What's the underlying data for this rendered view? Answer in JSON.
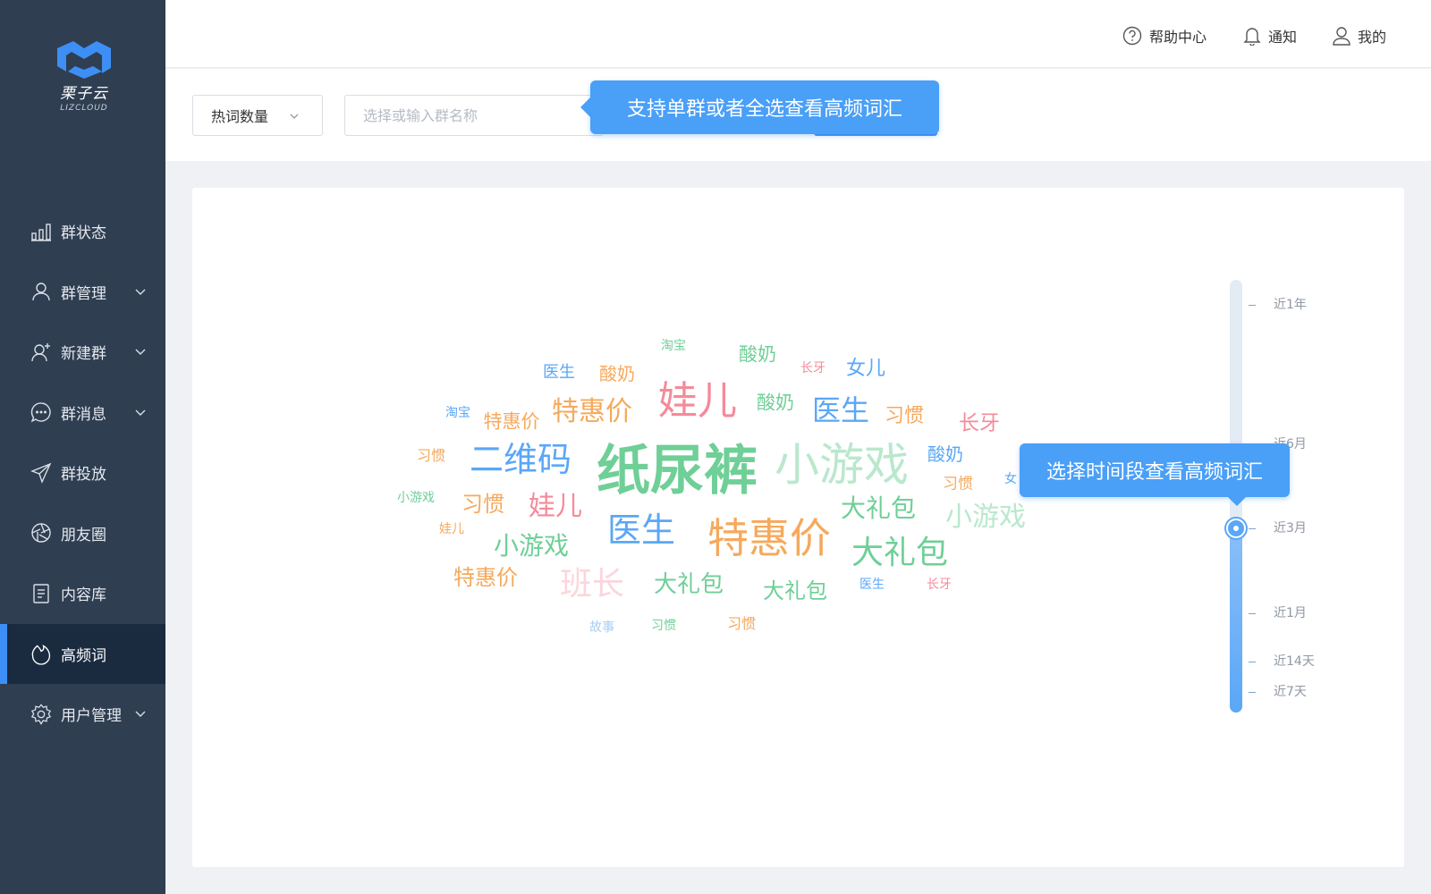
{
  "brand": {
    "name_cn": "栗子云",
    "name_en": "LIZCLOUD",
    "color": "#3d8ff5"
  },
  "sidebar": {
    "items": [
      {
        "label": "群状态",
        "icon": "bar-chart-icon",
        "has_submenu": false
      },
      {
        "label": "群管理",
        "icon": "user-icon",
        "has_submenu": true
      },
      {
        "label": "新建群",
        "icon": "add-user-icon",
        "has_submenu": true
      },
      {
        "label": "群消息",
        "icon": "chat-bubble-icon",
        "has_submenu": true
      },
      {
        "label": "群投放",
        "icon": "paper-plane-icon",
        "has_submenu": false
      },
      {
        "label": "朋友圈",
        "icon": "aperture-icon",
        "has_submenu": false
      },
      {
        "label": "内容库",
        "icon": "document-icon",
        "has_submenu": false
      },
      {
        "label": "高频词",
        "icon": "flame-icon",
        "has_submenu": false,
        "active": true
      },
      {
        "label": "用户管理",
        "icon": "gear-icon",
        "has_submenu": true
      }
    ]
  },
  "header": {
    "help": "帮助中心",
    "notify": "通知",
    "mine": "我的"
  },
  "filter": {
    "select_value": "热词数量",
    "search_placeholder": "选择或输入群名称"
  },
  "tooltips": {
    "group_tip": "支持单群或者全选查看高频词汇",
    "time_tip": "选择时间段查看高频词汇"
  },
  "colors": {
    "green": "#6fcf97",
    "orange": "#f5a95c",
    "blue": "#5aa7f7",
    "pink": "#f58a9a",
    "lightgreen": "#b9e8cd",
    "lightpink": "#fbd6dc",
    "lightblue": "#a9cdf3"
  },
  "wordcloud": [
    {
      "text": "纸尿裤",
      "color": "green"
    },
    {
      "text": "小游戏",
      "color": "lightgreen"
    },
    {
      "text": "特惠价",
      "color": "orange"
    },
    {
      "text": "娃儿",
      "color": "pink"
    },
    {
      "text": "二维码",
      "color": "blue"
    },
    {
      "text": "医生",
      "color": "blue"
    },
    {
      "text": "大礼包",
      "color": "green"
    },
    {
      "text": "班长",
      "color": "lightpink"
    },
    {
      "text": "特惠价",
      "color": "orange"
    },
    {
      "text": "医生",
      "color": "blue"
    },
    {
      "text": "大礼包",
      "color": "green"
    },
    {
      "text": "小游戏",
      "color": "green"
    },
    {
      "text": "小游戏",
      "color": "lightgreen"
    },
    {
      "text": "娃儿",
      "color": "pink"
    },
    {
      "text": "大礼包",
      "color": "green"
    },
    {
      "text": "大礼包",
      "color": "green"
    },
    {
      "text": "特惠价",
      "color": "orange"
    },
    {
      "text": "习惯",
      "color": "orange"
    },
    {
      "text": "特惠价",
      "color": "orange"
    },
    {
      "text": "习惯",
      "color": "orange"
    },
    {
      "text": "长牙",
      "color": "pink"
    },
    {
      "text": "女儿",
      "color": "blue"
    },
    {
      "text": "酸奶",
      "color": "blue"
    },
    {
      "text": "酸奶",
      "color": "green"
    },
    {
      "text": "酸奶",
      "color": "green"
    },
    {
      "text": "酸奶",
      "color": "orange"
    },
    {
      "text": "医生",
      "color": "blue"
    },
    {
      "text": "习惯",
      "color": "orange"
    },
    {
      "text": "习惯",
      "color": "orange"
    },
    {
      "text": "淘宝",
      "color": "green"
    },
    {
      "text": "长牙",
      "color": "pink"
    },
    {
      "text": "淘宝",
      "color": "blue"
    },
    {
      "text": "习惯",
      "color": "orange"
    },
    {
      "text": "小游戏",
      "color": "green"
    },
    {
      "text": "娃儿",
      "color": "orange"
    },
    {
      "text": "习惯",
      "color": "green"
    },
    {
      "text": "故事",
      "color": "lightblue"
    },
    {
      "text": "医生",
      "color": "blue"
    },
    {
      "text": "长牙",
      "color": "pink"
    },
    {
      "text": "女",
      "color": "blue"
    }
  ],
  "time_slider": {
    "options": [
      "近1年",
      "近6月",
      "近3月",
      "近1月",
      "近14天",
      "近7天"
    ],
    "selected": "近3月"
  }
}
